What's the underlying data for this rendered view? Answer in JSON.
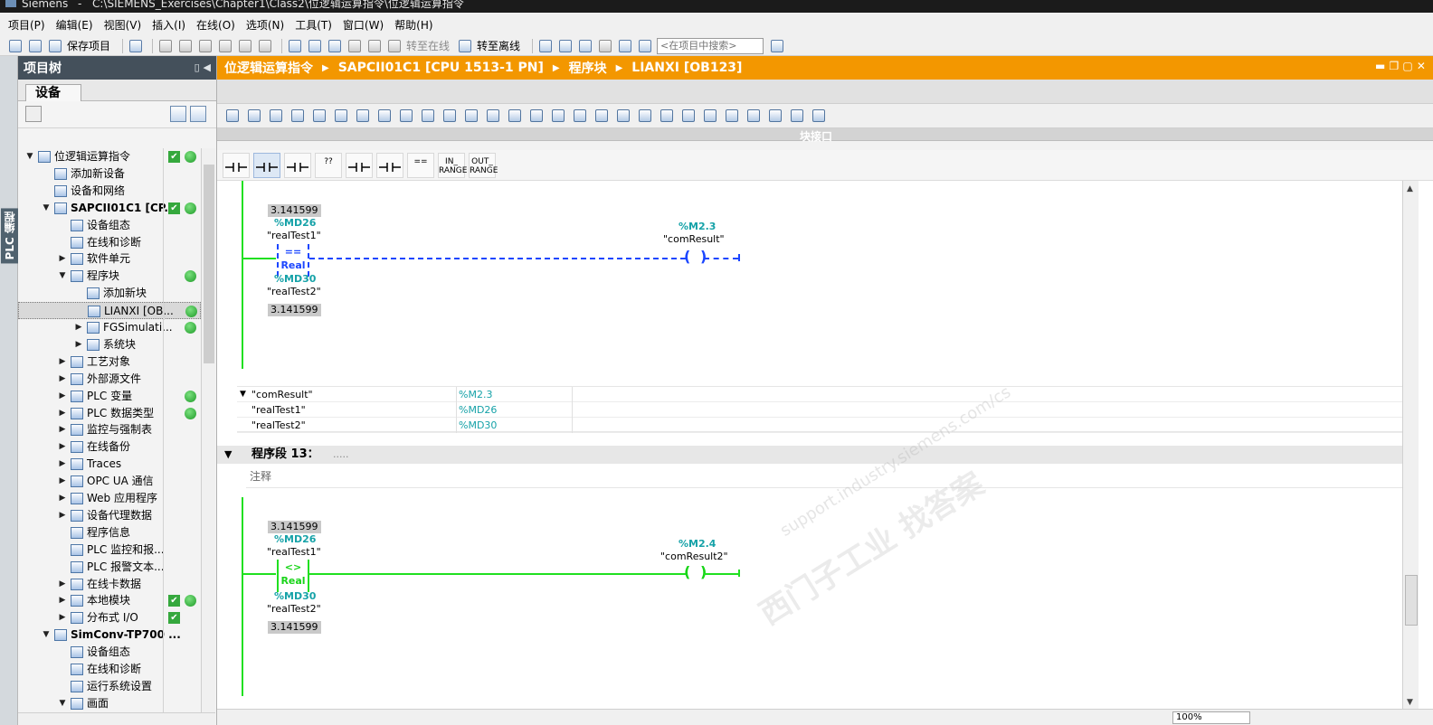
{
  "window": {
    "app_name": "Siemens",
    "separator": "-",
    "path": "C:\\SIEMENS_Exercises\\Chapter1\\Class2\\位逻辑运算指令\\位逻辑运算指令"
  },
  "menu": [
    "项目(P)",
    "编辑(E)",
    "视图(V)",
    "插入(I)",
    "在线(O)",
    "选项(N)",
    "工具(T)",
    "窗口(W)",
    "帮助(H)"
  ],
  "toolbar": {
    "save_label": "保存项目",
    "go_online": "转至在线",
    "go_offline": "转至离线",
    "search_placeholder": "<在项目中搜索>"
  },
  "sidebar_tab": "PLC 编程",
  "project_tree": {
    "title": "项目树",
    "tab": "设备",
    "items": [
      {
        "label": "位逻辑运算指令",
        "level": 0,
        "expander": "open",
        "check": true,
        "dot": true
      },
      {
        "label": "添加新设备",
        "level": 1,
        "expander": "none"
      },
      {
        "label": "设备和网络",
        "level": 1,
        "expander": "none"
      },
      {
        "label": "SAPCII01C1 [CP...",
        "level": 1,
        "expander": "open",
        "check": true,
        "dot": true,
        "bold": true
      },
      {
        "label": "设备组态",
        "level": 2,
        "expander": "none"
      },
      {
        "label": "在线和诊断",
        "level": 2,
        "expander": "none"
      },
      {
        "label": "软件单元",
        "level": 2,
        "expander": "closed"
      },
      {
        "label": "程序块",
        "level": 2,
        "expander": "open",
        "dot": true
      },
      {
        "label": "添加新块",
        "level": 3,
        "expander": "none"
      },
      {
        "label": "LIANXI [OB...",
        "level": 3,
        "expander": "none",
        "dot": true,
        "selected": true
      },
      {
        "label": "FGSimulati...",
        "level": 3,
        "expander": "closed",
        "dot": true
      },
      {
        "label": "系统块",
        "level": 3,
        "expander": "closed"
      },
      {
        "label": "工艺对象",
        "level": 2,
        "expander": "closed"
      },
      {
        "label": "外部源文件",
        "level": 2,
        "expander": "closed"
      },
      {
        "label": "PLC 变量",
        "level": 2,
        "expander": "closed",
        "dot": true
      },
      {
        "label": "PLC 数据类型",
        "level": 2,
        "expander": "closed",
        "dot": true
      },
      {
        "label": "监控与强制表",
        "level": 2,
        "expander": "closed"
      },
      {
        "label": "在线备份",
        "level": 2,
        "expander": "closed"
      },
      {
        "label": "Traces",
        "level": 2,
        "expander": "closed"
      },
      {
        "label": "OPC UA 通信",
        "level": 2,
        "expander": "closed"
      },
      {
        "label": "Web 应用程序",
        "level": 2,
        "expander": "closed"
      },
      {
        "label": "设备代理数据",
        "level": 2,
        "expander": "closed"
      },
      {
        "label": "程序信息",
        "level": 2,
        "expander": "none"
      },
      {
        "label": "PLC 监控和报...",
        "level": 2,
        "expander": "none"
      },
      {
        "label": "PLC 报警文本...",
        "level": 2,
        "expander": "none"
      },
      {
        "label": "在线卡数据",
        "level": 2,
        "expander": "closed"
      },
      {
        "label": "本地模块",
        "level": 2,
        "expander": "closed",
        "check": true,
        "dot": true
      },
      {
        "label": "分布式 I/O",
        "level": 2,
        "expander": "closed",
        "check": true
      },
      {
        "label": "SimConv-TP700 ...",
        "level": 1,
        "expander": "open",
        "bold": true
      },
      {
        "label": "设备组态",
        "level": 2,
        "expander": "none"
      },
      {
        "label": "在线和诊断",
        "level": 2,
        "expander": "none"
      },
      {
        "label": "运行系统设置",
        "level": 2,
        "expander": "none"
      },
      {
        "label": "画面",
        "level": 2,
        "expander": "open"
      }
    ]
  },
  "editor": {
    "breadcrumb": [
      "位逻辑运算指令",
      "SAPCII01C1 [CPU 1513-1 PN]",
      "程序块",
      "LIANXI [OB123]"
    ],
    "interface_label": "块接口",
    "instructions": [
      {
        "id": "no-contact",
        "label": ""
      },
      {
        "id": "nc-contact",
        "label": ""
      },
      {
        "id": "coil",
        "label": ""
      },
      {
        "id": "empty-box",
        "label": "??"
      },
      {
        "id": "branch-open",
        "label": ""
      },
      {
        "id": "branch-close",
        "label": ""
      },
      {
        "id": "compare",
        "label": "=="
      },
      {
        "id": "in-range",
        "label": "IN_\nRANGE"
      },
      {
        "id": "out-range",
        "label": "OUT_\nRANGE"
      }
    ],
    "network12": {
      "in1_value": "3.141599",
      "in1_addr": "%MD26",
      "in1_tag": "\"realTest1\"",
      "op": "==",
      "type": "Real",
      "in2_addr": "%MD30",
      "in2_tag": "\"realTest2\"",
      "in2_value": "3.141599",
      "coil_addr": "%M2.3",
      "coil_tag": "\"comResult\"",
      "state": "not-fulfilled"
    },
    "xref_table": [
      {
        "name": "\"comResult\"",
        "addr": "%M2.3",
        "toggle": "▼"
      },
      {
        "name": "\"realTest1\"",
        "addr": "%MD26"
      },
      {
        "name": "\"realTest2\"",
        "addr": "%MD30"
      }
    ],
    "network13": {
      "title": "程序段 13：",
      "desc": ".....",
      "comment": "注释",
      "in1_value": "3.141599",
      "in1_addr": "%MD26",
      "in1_tag": "\"realTest1\"",
      "op": "<>",
      "type": "Real",
      "in2_addr": "%MD30",
      "in2_tag": "\"realTest2\"",
      "in2_value": "3.141599",
      "coil_addr": "%M2.4",
      "coil_tag": "\"comResult2\"",
      "state": "fulfilled"
    },
    "zoom": "100%"
  },
  "watermark": {
    "line1": "support.industry.siemens.com/cs",
    "line2": "西门子工业  找答案"
  },
  "colors": {
    "editor_header": "#f39700",
    "tree_header": "#44505b",
    "status_ok": "#35a83d",
    "rung_active": "#20e020",
    "rung_inactive": "#1b46ff",
    "address": "#16a2a8"
  }
}
